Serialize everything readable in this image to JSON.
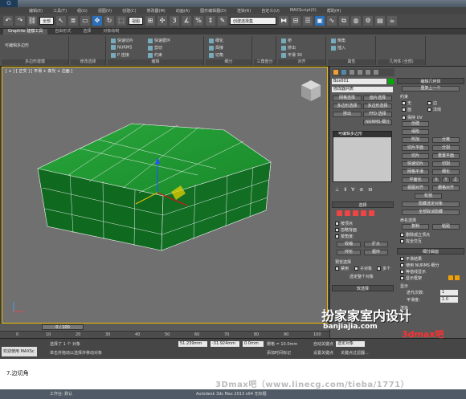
{
  "menubar": [
    "编辑(E)",
    "工具(T)",
    "组(G)",
    "视图(V)",
    "创建(C)",
    "修改器(M)",
    "动画(A)",
    "图形编辑器(D)",
    "渲染(R)",
    "自定义(U)",
    "MAXScript(X)",
    "帮助(H)"
  ],
  "toolbar": {
    "selection_filter": "全部",
    "view_dropdown": "视图",
    "named_sel": "创建选择集"
  },
  "ribbon": {
    "tabs": [
      "Graphite 建模工具",
      "自由形式",
      "选择",
      "对象绘制"
    ],
    "groups": [
      "多边形建模",
      "修改选择",
      "编辑",
      "几何体 (全部)",
      "细分",
      "三角剖分",
      "对齐",
      "属性"
    ],
    "items": [
      "快速切片",
      "快速循环",
      "NURMS",
      "剪切",
      "P 连接",
      "约束",
      "细化",
      "焊接",
      "切角",
      "桥",
      "挤出",
      "倒角",
      "插入",
      "平滑 30",
      "使用显示",
      "生成拓扑"
    ],
    "poly_items": [
      "可编辑多边形"
    ]
  },
  "viewport": {
    "label": "[ + ] [ 正交 ] [ 平滑 + 高光 + 边面 ]"
  },
  "trackbar": {
    "frame": "0 / 100",
    "ticks": [
      "0",
      "10",
      "20",
      "30",
      "40",
      "50",
      "60",
      "70",
      "80",
      "90",
      "100"
    ]
  },
  "statusbar": {
    "cmd": "欢迎使用 MAXSc",
    "line1": "选择了 1 个 对象",
    "line2": "单击并拖动以选择并移动对象",
    "x": "51.239mm",
    "y": "-31.924mm",
    "z": "0.0mm",
    "grid": "栅格 = 10.0mm",
    "autokey": "自动关键点",
    "selected": "选定对象",
    "setkey": "设置关键点",
    "keyfilter": "关键点过滤器...",
    "addtime": "添加时间标记"
  },
  "panel": {
    "object_name": "Box001",
    "modifier_list": "修改器列表",
    "buttons": [
      "网格选择",
      "面片选择",
      "多边形选择",
      "多边形选择",
      "挤出",
      "FFD 选择",
      "编辑多边形",
      "NURMS 细分"
    ],
    "stack_item": "可编辑多边形",
    "select_head": "选择",
    "select_opts": [
      "按顶点",
      "忽略背面",
      "按角度:"
    ],
    "shrink": "收缩",
    "grow": "扩大",
    "ring": "环形",
    "loop": "循环",
    "preview": "预览选择",
    "preview_opts": [
      "禁用",
      "子对象",
      "多个"
    ],
    "sel_count": "选定整个对象",
    "soft_sel": "软选择"
  },
  "panel2": {
    "head1": "编辑几何体",
    "repeat": "重复上一个",
    "constraint": "约束",
    "cons_opts": [
      "无",
      "边",
      "面",
      "法线"
    ],
    "keep_uv": "保持 UV",
    "create": "创建",
    "collapse": "塌陷",
    "attach": "附加",
    "detach": "分离",
    "slice_plane": "切片平面",
    "split": "分割",
    "slice": "切片",
    "reset_plane": "重置平面",
    "quickslice": "快速切片",
    "cut": "切割",
    "mesh_smooth": "网格平滑",
    "tessellate": "细化",
    "make_planar": "平面化",
    "xyz": [
      "X",
      "Y",
      "Z"
    ],
    "view_align": "视图对齐",
    "grid_align": "栅格对齐",
    "relax": "松弛",
    "hide_sel": "隐藏选定对象",
    "unhide_all": "全部取消隐藏",
    "named_sel": "命名选择",
    "copy": "复制",
    "paste": "粘贴",
    "delete_iso": "删除孤立顶点",
    "full_interact": "完全交互",
    "subdiv_head": "细分曲面",
    "subdiv_opts": [
      "平滑结果",
      "使用 NURMS 细分",
      "等值线显示",
      "显示框架"
    ],
    "display": "显示",
    "iterations": "迭代次数:",
    "iter_val": "1",
    "smoothness": "平滑度:",
    "smooth_val": "1.0",
    "render": "渲染"
  },
  "watermark": {
    "title": "扮家家室内设计",
    "site": "banjiajia.com",
    "site2": "3dmax吧"
  },
  "caption": "7.边切角",
  "watermark2": "3Dmax吧（www.linecg.com/tieba/1771）",
  "second": {
    "title": "Autodesk 3ds Max 2013 x64   无标题",
    "workspace": "工作台: 默认"
  }
}
